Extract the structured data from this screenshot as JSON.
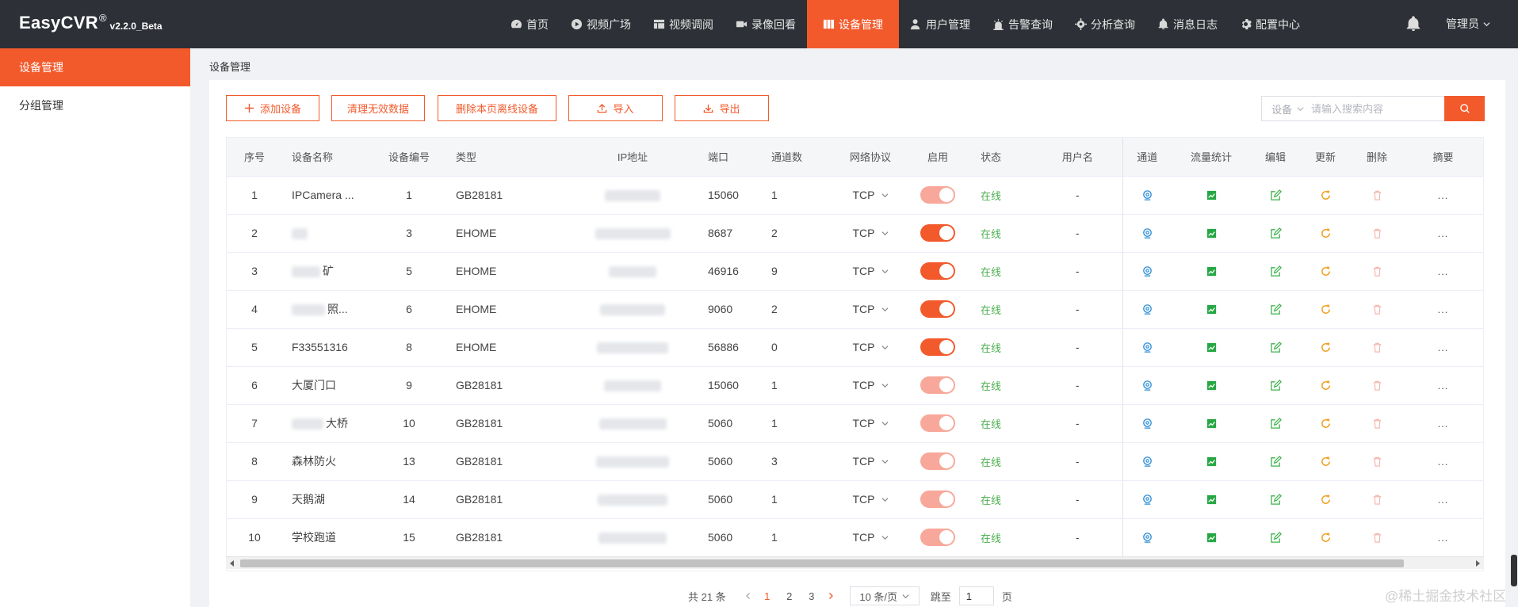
{
  "brand": {
    "name": "EasyCVR",
    "reg": "®",
    "version": "v2.2.0_Beta"
  },
  "nav": [
    {
      "label": "首页",
      "icon": "dashboard-icon"
    },
    {
      "label": "视频广场",
      "icon": "play-circle-icon"
    },
    {
      "label": "视频调阅",
      "icon": "grid-icon"
    },
    {
      "label": "录像回看",
      "icon": "video-camera-icon"
    },
    {
      "label": "设备管理",
      "icon": "device-icon",
      "active": true
    },
    {
      "label": "用户管理",
      "icon": "user-icon"
    },
    {
      "label": "告警查询",
      "icon": "alarm-icon"
    },
    {
      "label": "分析查询",
      "icon": "analysis-icon"
    },
    {
      "label": "消息日志",
      "icon": "bell-small-icon"
    },
    {
      "label": "配置中心",
      "icon": "gear-icon"
    }
  ],
  "header": {
    "user": "管理员"
  },
  "sidebar": {
    "items": [
      {
        "label": "设备管理",
        "active": true
      },
      {
        "label": "分组管理"
      }
    ]
  },
  "breadcrumb": "设备管理",
  "toolbar": {
    "add": "添加设备",
    "clean": "清理无效数据",
    "delete_offline": "删除本页离线设备",
    "import": "导入",
    "export": "导出"
  },
  "search": {
    "type": "设备",
    "placeholder": "请输入搜索内容"
  },
  "table": {
    "columns": [
      "序号",
      "设备名称",
      "设备编号",
      "类型",
      "IP地址",
      "端口",
      "通道数",
      "网络协议",
      "启用",
      "状态",
      "用户名",
      "通道",
      "流量统计",
      "编辑",
      "更新",
      "删除",
      "摘要"
    ],
    "rows": [
      {
        "no": "1",
        "name": "IPCamera ...",
        "code": "1",
        "type": "GB28181",
        "port": "15060",
        "channels": "1",
        "proto": "TCP",
        "enabled": "dim",
        "status": "在线",
        "user": "-",
        "summary": "..."
      },
      {
        "no": "2",
        "name": "",
        "code": "3",
        "type": "EHOME",
        "port": "8687",
        "channels": "2",
        "proto": "TCP",
        "enabled": "on",
        "status": "在线",
        "user": "-",
        "summary": "..."
      },
      {
        "no": "3",
        "name": "矿",
        "code": "5",
        "type": "EHOME",
        "port": "46916",
        "channels": "9",
        "proto": "TCP",
        "enabled": "on",
        "status": "在线",
        "user": "-",
        "summary": "..."
      },
      {
        "no": "4",
        "name": "照...",
        "code": "6",
        "type": "EHOME",
        "port": "9060",
        "channels": "2",
        "proto": "TCP",
        "enabled": "on",
        "status": "在线",
        "user": "-",
        "summary": "..."
      },
      {
        "no": "5",
        "name": "F33551316",
        "code": "8",
        "type": "EHOME",
        "port": "56886",
        "channels": "0",
        "proto": "TCP",
        "enabled": "on",
        "status": "在线",
        "user": "-",
        "summary": "..."
      },
      {
        "no": "6",
        "name": "大厦门口",
        "code": "9",
        "type": "GB28181",
        "port": "15060",
        "channels": "1",
        "proto": "TCP",
        "enabled": "dim",
        "status": "在线",
        "user": "-",
        "summary": "..."
      },
      {
        "no": "7",
        "name": "大桥",
        "code": "10",
        "type": "GB28181",
        "port": "5060",
        "channels": "1",
        "proto": "TCP",
        "enabled": "dim",
        "status": "在线",
        "user": "-",
        "summary": "..."
      },
      {
        "no": "8",
        "name": "森林防火",
        "code": "13",
        "type": "GB28181",
        "port": "5060",
        "channels": "3",
        "proto": "TCP",
        "enabled": "dim",
        "status": "在线",
        "user": "-",
        "summary": "..."
      },
      {
        "no": "9",
        "name": "天鹅湖",
        "code": "14",
        "type": "GB28181",
        "port": "5060",
        "channels": "1",
        "proto": "TCP",
        "enabled": "dim",
        "status": "在线",
        "user": "-",
        "summary": "..."
      },
      {
        "no": "10",
        "name": "学校跑道",
        "code": "15",
        "type": "GB28181",
        "port": "5060",
        "channels": "1",
        "proto": "TCP",
        "enabled": "dim",
        "status": "在线",
        "user": "-",
        "summary": "..."
      }
    ]
  },
  "pagination": {
    "total": "共 21 条",
    "pages": [
      "1",
      "2",
      "3"
    ],
    "current": "1",
    "page_size": "10 条/页",
    "goto_label": "跳至",
    "goto_value": "1",
    "page_unit": "页"
  },
  "watermark": "@稀土掘金技术社区",
  "colors": {
    "accent": "#f25a2c",
    "online": "#4caf50",
    "topbar": "#2d3036"
  }
}
